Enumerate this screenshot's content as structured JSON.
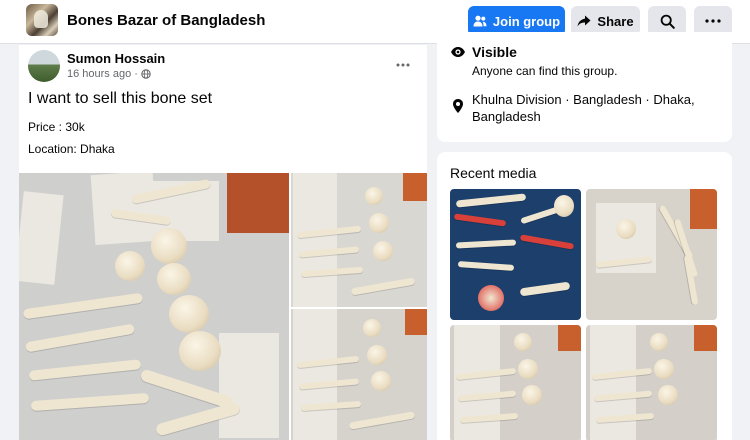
{
  "header": {
    "group_name": "Bones Bazar of Bangladesh",
    "join_label": "Join group",
    "share_label": "Share",
    "icons": {
      "join": "people-icon",
      "share": "share-arrow-icon",
      "search": "search-icon",
      "more": "ellipsis-icon"
    },
    "accent_color": "#1877f2"
  },
  "post": {
    "author": "Sumon Hossain",
    "time": "16 hours ago",
    "audience_icon": "globe-icon",
    "title": "I want to sell this bone set",
    "price": "Price : 30k",
    "location": "Location: Dhaka",
    "photo_count_shown": 3
  },
  "about": {
    "visible_title": "Visible",
    "visible_desc": "Anyone can find this group.",
    "location": "Khulna Division · Bangladesh · Dhaka, Bangladesh",
    "icons": {
      "visible": "eye-icon",
      "location": "location-pin-icon"
    }
  },
  "media": {
    "title": "Recent media",
    "thumbnail_count": 4
  }
}
